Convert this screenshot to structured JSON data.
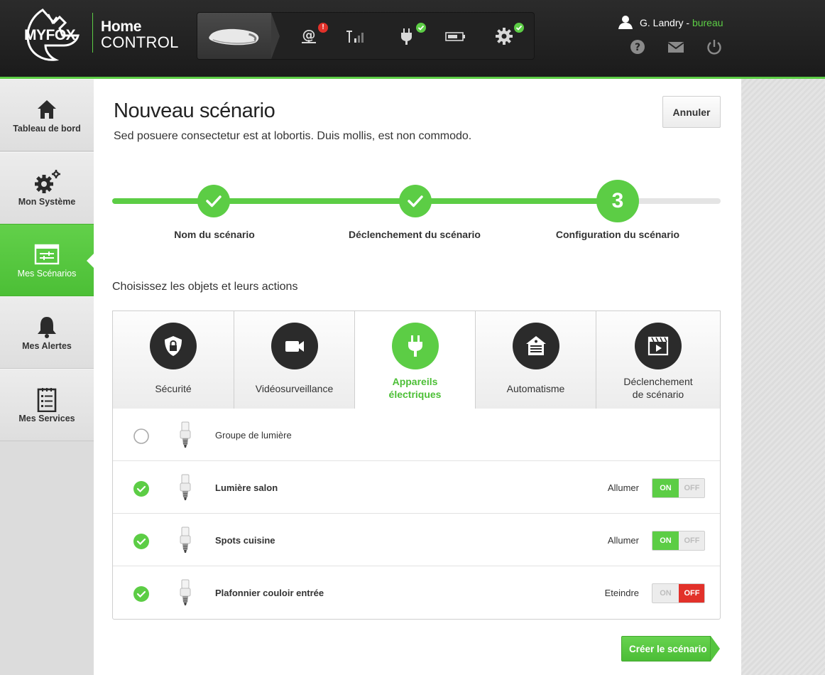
{
  "brand": {
    "name": "MYFOX",
    "home": "Home",
    "control": "CONTROL"
  },
  "status_icons": [
    {
      "icon": "email-network-icon",
      "badge": "!",
      "badge_color": "#e2312a"
    },
    {
      "icon": "signal-antenna-icon",
      "badge": null
    },
    {
      "icon": "power-plug-icon",
      "badge": "check",
      "badge_color": "#5ccd45"
    },
    {
      "icon": "battery-icon",
      "badge": null
    },
    {
      "icon": "gear-icon",
      "badge": "check",
      "badge_color": "#5ccd45"
    }
  ],
  "user": {
    "name": "G. Landry",
    "separator": " - ",
    "place": "bureau"
  },
  "sidebar": {
    "items": [
      {
        "label": "Tableau de bord",
        "icon": "home-icon"
      },
      {
        "label": "Mon Système",
        "icon": "gears-icon"
      },
      {
        "label": "Mes Scénarios",
        "icon": "scenario-icon",
        "active": true
      },
      {
        "label": "Mes Alertes",
        "icon": "bell-icon"
      },
      {
        "label": "Mes Services",
        "icon": "clipboard-icon"
      }
    ]
  },
  "page": {
    "title": "Nouveau scénario",
    "subtitle": "Sed posuere consectetur est at lobortis. Duis mollis, est non commodo.",
    "cancel_label": "Annuler",
    "create_label": "Créer le scénario"
  },
  "steps": [
    {
      "label": "Nom du scénario",
      "state": "done"
    },
    {
      "label": "Déclenchement du scénario",
      "state": "done"
    },
    {
      "label": "Configuration du scénario",
      "state": "current",
      "number": "3"
    }
  ],
  "section_title": "Choisissez les objets et leurs actions",
  "categories": [
    {
      "line1": "Sécurité",
      "line2": "",
      "icon": "shield-lock-icon"
    },
    {
      "line1": "Vidéosurveillance",
      "line2": "",
      "icon": "camera-icon"
    },
    {
      "line1": "Appareils",
      "line2": "électriques",
      "icon": "plug-icon",
      "active": true
    },
    {
      "line1": "Automatisme",
      "line2": "",
      "icon": "garage-icon"
    },
    {
      "line1": "Déclenchement",
      "line2": "de scénario",
      "icon": "clapper-icon"
    }
  ],
  "devices": [
    {
      "name": "Groupe de lumière",
      "selected": false,
      "action": "",
      "on_label": "",
      "off_label": "",
      "state": ""
    },
    {
      "name": "Lumière salon",
      "selected": true,
      "action": "Allumer",
      "on_label": "ON",
      "off_label": "OFF",
      "state": "on"
    },
    {
      "name": "Spots cuisine",
      "selected": true,
      "action": "Allumer",
      "on_label": "ON",
      "off_label": "OFF",
      "state": "on"
    },
    {
      "name": "Plafonnier couloir entrée",
      "selected": true,
      "action": "Eteindre",
      "on_label": "ON",
      "off_label": "OFF",
      "state": "off"
    }
  ],
  "colors": {
    "accent": "#5ccd45",
    "danger": "#e2312a",
    "dark": "#2b2b2b"
  }
}
